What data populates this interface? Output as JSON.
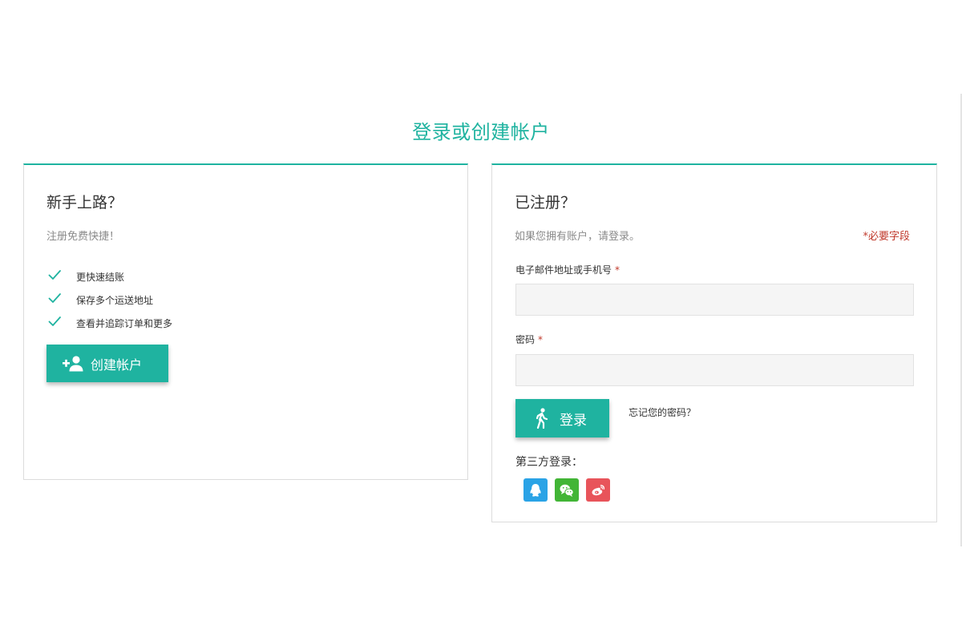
{
  "page": {
    "title": "登录或创建帐户"
  },
  "colors": {
    "accent": "#1fb3a0",
    "required": "#c0392b",
    "qq": "#2aa3e6",
    "wechat": "#42b536",
    "weibo": "#e8545a"
  },
  "new_customer": {
    "heading": "新手上路？",
    "subtitle": "注册免费快捷！",
    "benefits": [
      {
        "text": "更快速结账",
        "icon": "check-icon"
      },
      {
        "text": "保存多个运送地址",
        "icon": "check-icon"
      },
      {
        "text": "查看并追踪订单和更多",
        "icon": "check-icon"
      }
    ],
    "create_button": {
      "label": "创建帐户",
      "icon": "add-user-icon"
    }
  },
  "registered": {
    "heading": "已注册？",
    "subtitle": "如果您拥有账户，请登录。",
    "required_note": "*必要字段",
    "email_field": {
      "label": "电子邮件地址或手机号",
      "required_mark": "*",
      "value": "",
      "placeholder": ""
    },
    "password_field": {
      "label": "密码",
      "required_mark": "*",
      "value": "",
      "placeholder": ""
    },
    "login_button": {
      "label": "登录",
      "icon": "walking-person-icon"
    },
    "forgot_password": "忘记您的密码？",
    "third_party": {
      "label": "第三方登录：",
      "providers": [
        {
          "name": "qq",
          "icon": "qq-icon"
        },
        {
          "name": "wechat",
          "icon": "wechat-icon"
        },
        {
          "name": "weibo",
          "icon": "weibo-icon"
        }
      ]
    }
  }
}
